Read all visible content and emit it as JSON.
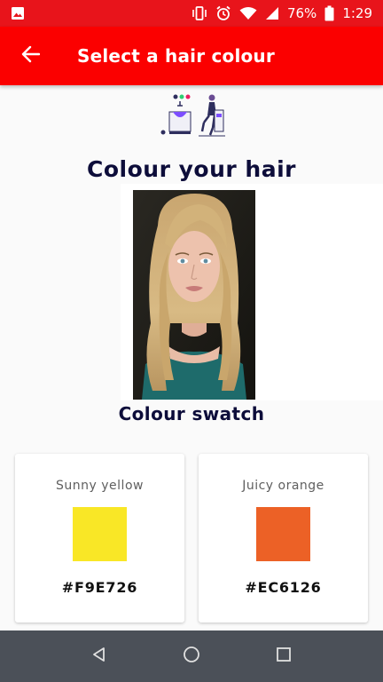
{
  "status_bar": {
    "battery": "76%",
    "time": "1:29",
    "icons": [
      "gallery-icon",
      "vibrate-icon",
      "alarm-icon",
      "wifi-icon",
      "signal-icon",
      "battery-icon"
    ]
  },
  "app_bar": {
    "back_icon": "arrow-left-icon",
    "title": "Select a hair colour"
  },
  "main": {
    "heading": "Colour your hair",
    "subheading": "Colour swatch"
  },
  "swatches": [
    {
      "name": "Sunny yellow",
      "hex": "#F9E726",
      "color": "#F9E726"
    },
    {
      "name": "Juicy orange",
      "hex": "#EC6126",
      "color": "#EC6126"
    }
  ],
  "colors": {
    "app_bar": "#FB0000",
    "status_bar": "#E8141B",
    "heading_text": "#0D0D3A",
    "nav_bar": "#4B5058"
  },
  "nav_bar": {
    "icons": [
      "back-triangle-icon",
      "home-circle-icon",
      "recents-square-icon"
    ]
  }
}
